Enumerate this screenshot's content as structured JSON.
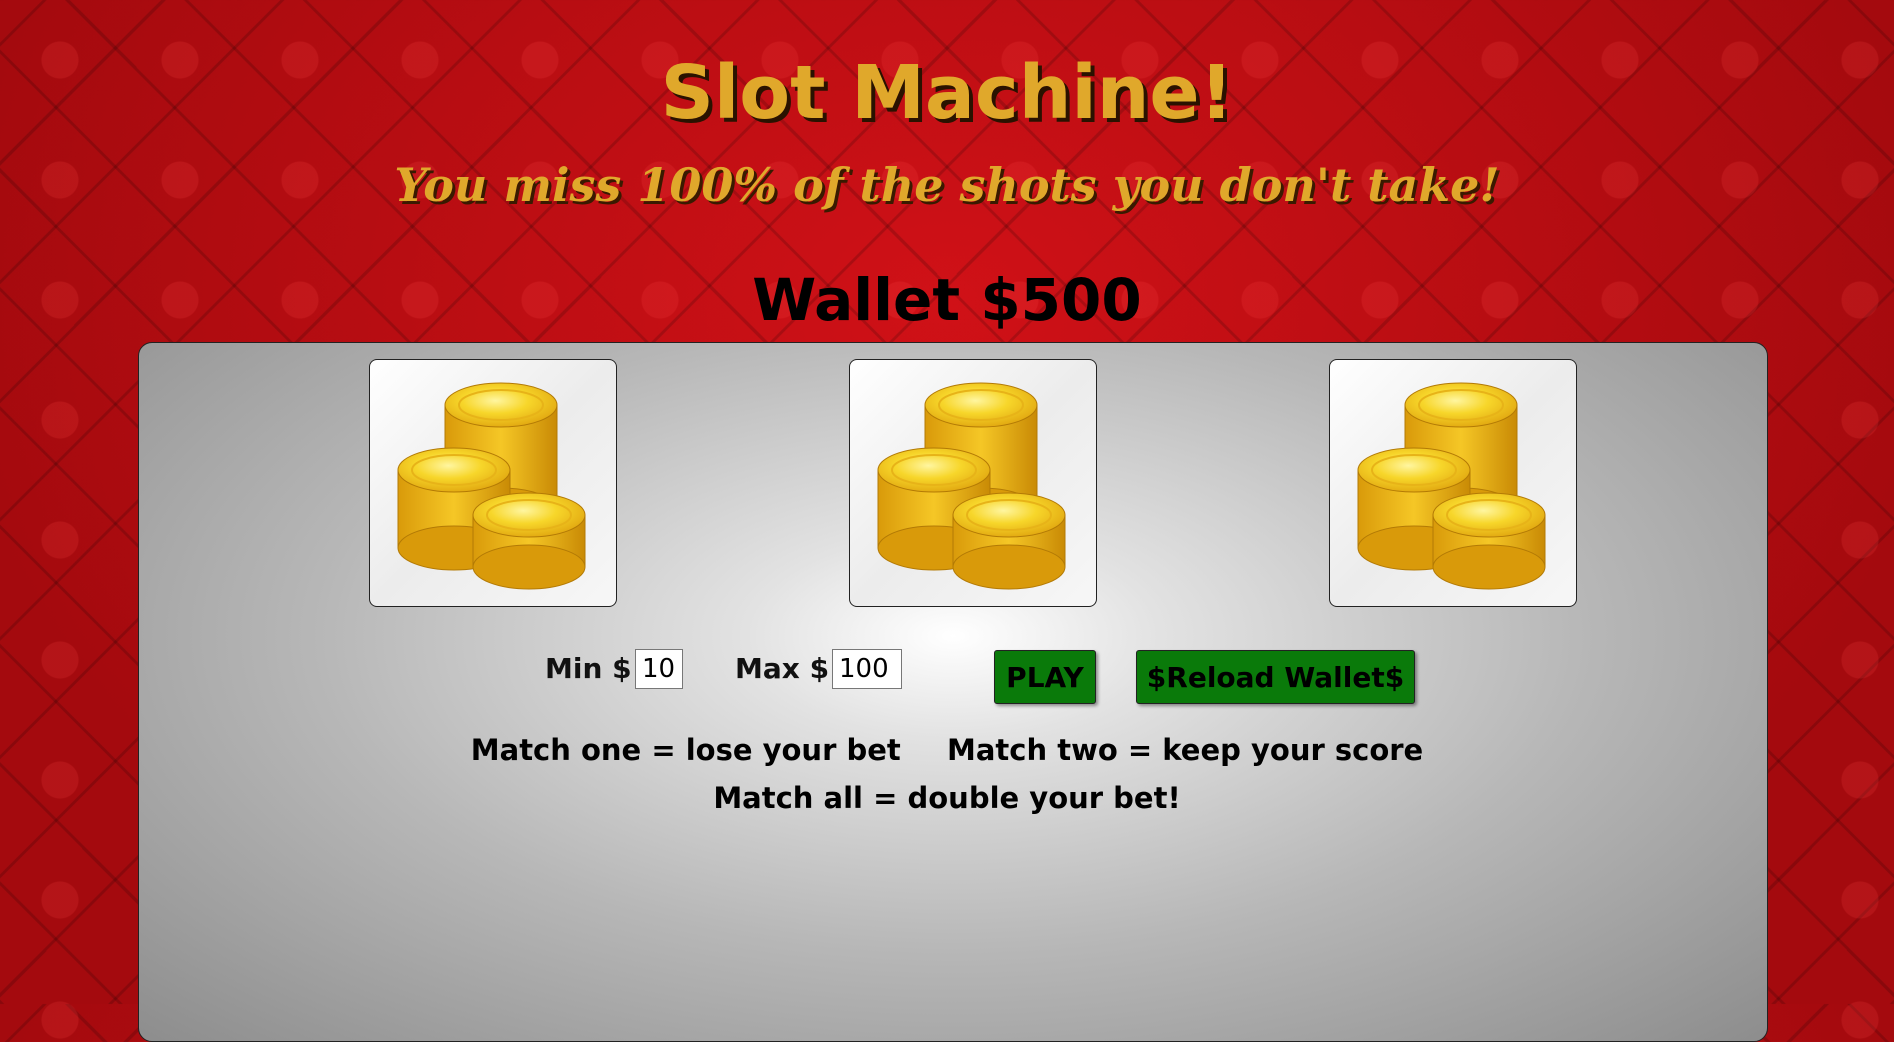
{
  "header": {
    "title": "Slot Machine!",
    "tagline": "You miss 100% of the shots you don't take!"
  },
  "wallet": {
    "label": "Wallet $500",
    "amount": 500
  },
  "reels": [
    {
      "symbol": "gold-coins-icon"
    },
    {
      "symbol": "gold-coins-icon"
    },
    {
      "symbol": "gold-coins-icon"
    }
  ],
  "bet": {
    "min_label": "Min $",
    "min_value": "10",
    "max_label": "Max $",
    "max_value": "100"
  },
  "buttons": {
    "play": "PLAY",
    "reload": "$Reload Wallet$"
  },
  "rules": {
    "match_one": "Match one = lose your bet",
    "match_two": "Match two = keep your score",
    "match_all": "Match all = double your bet!"
  },
  "colors": {
    "background": "#b40a0f",
    "title": "#e0a82b",
    "button": "#0a7a0a",
    "coin": "#f2c81a"
  }
}
